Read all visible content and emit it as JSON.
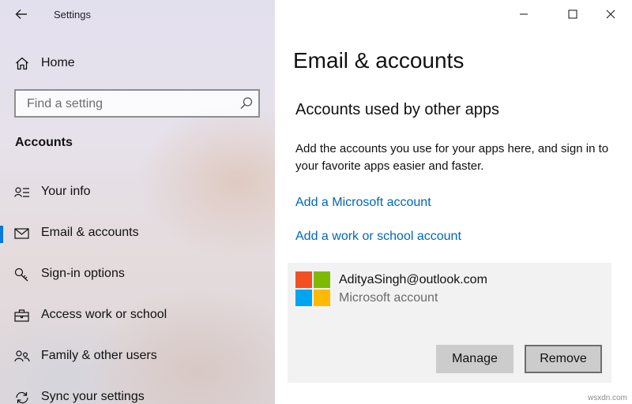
{
  "window": {
    "title": "Settings",
    "controls": {
      "minimize": "minimize",
      "maximize": "maximize",
      "close": "close"
    }
  },
  "sidebar": {
    "home_label": "Home",
    "search": {
      "placeholder": "Find a setting",
      "value": ""
    },
    "section_heading": "Accounts",
    "items": [
      {
        "label": "Your info",
        "icon": "person-list-icon",
        "selected": false
      },
      {
        "label": "Email & accounts",
        "icon": "envelope-icon",
        "selected": true
      },
      {
        "label": "Sign-in options",
        "icon": "key-icon",
        "selected": false
      },
      {
        "label": "Access work or school",
        "icon": "briefcase-icon",
        "selected": false
      },
      {
        "label": "Family & other users",
        "icon": "people-icon",
        "selected": false
      },
      {
        "label": "Sync your settings",
        "icon": "sync-icon",
        "selected": false
      }
    ]
  },
  "main": {
    "title": "Email & accounts",
    "subheading": "Accounts used by other apps",
    "description": "Add the accounts you use for your apps here, and sign in to your favorite apps easier and faster.",
    "links": {
      "add_microsoft": "Add a Microsoft account",
      "add_work_school": "Add a work or school account"
    },
    "account": {
      "email": "AdityaSingh@outlook.com",
      "type": "Microsoft account",
      "manage_label": "Manage",
      "remove_label": "Remove"
    }
  },
  "colors": {
    "accent": "#0078d7",
    "link": "#0067b8",
    "logo_red": "#f25022",
    "logo_green": "#7fba00",
    "logo_blue": "#00a4ef",
    "logo_yellow": "#ffb900"
  },
  "watermark": "wsxdn.com"
}
